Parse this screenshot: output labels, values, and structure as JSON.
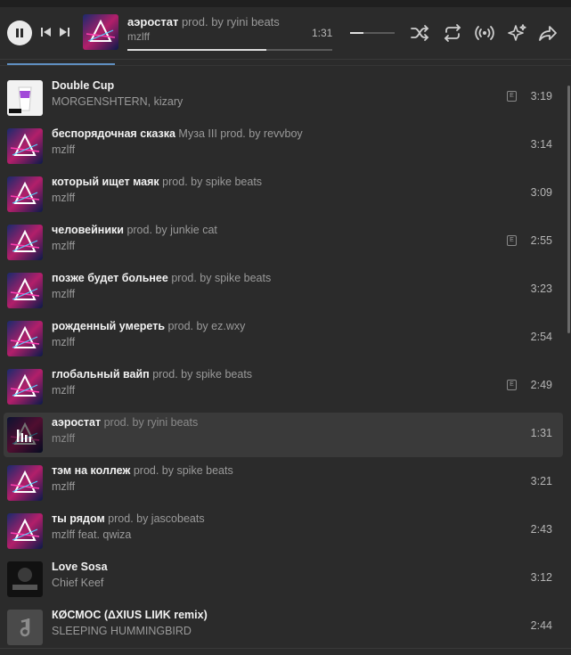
{
  "now_playing": {
    "title": "аэростат",
    "title_suffix": "prod. by ryini beats",
    "artist": "mzlff",
    "time": "1:31",
    "progress": 0.68,
    "volume": 0.3
  },
  "icons": {
    "play_pause": "pause-icon",
    "prev": "previous-icon",
    "next": "next-icon",
    "shuffle": "shuffle-icon",
    "repeat": "repeat-icon",
    "broadcast": "broadcast-icon",
    "sparkle": "sparkle-icon",
    "share": "share-icon"
  },
  "colors": {
    "accent": "#5f8fc1",
    "active_row": "#3a3a3a"
  },
  "tracks": [
    {
      "title": "Double Cup",
      "suffix": "",
      "artist": "MORGENSHTERN, kizary",
      "duration": "3:19",
      "explicit": "E",
      "cover": "doublecup"
    },
    {
      "title": "беспорядочная сказка",
      "suffix": "Муза III prod. by revvboy",
      "artist": "mzlff",
      "duration": "3:14",
      "explicit": "",
      "cover": "neon"
    },
    {
      "title": "который ищет маяк",
      "suffix": "prod. by spike beats",
      "artist": "mzlff",
      "duration": "3:09",
      "explicit": "",
      "cover": "neon"
    },
    {
      "title": "человейники",
      "suffix": "prod. by junkie cat",
      "artist": "mzlff",
      "duration": "2:55",
      "explicit": "E",
      "cover": "neon"
    },
    {
      "title": "позже будет больнее",
      "suffix": "prod. by spike beats",
      "artist": "mzlff",
      "duration": "3:23",
      "explicit": "",
      "cover": "neon"
    },
    {
      "title": "рожденный умереть",
      "suffix": "prod. by ez.wxy",
      "artist": "mzlff",
      "duration": "2:54",
      "explicit": "",
      "cover": "neon"
    },
    {
      "title": "глобальный вайп",
      "suffix": "prod. by spike beats",
      "artist": "mzlff",
      "duration": "2:49",
      "explicit": "E",
      "cover": "neon"
    },
    {
      "title": "аэростат",
      "suffix": "prod. by ryini beats",
      "artist": "mzlff",
      "duration": "1:31",
      "explicit": "",
      "cover": "playing",
      "active": true
    },
    {
      "title": "тэм на коллеж",
      "suffix": "prod. by spike beats",
      "artist": "mzlff",
      "duration": "3:21",
      "explicit": "",
      "cover": "neon"
    },
    {
      "title": "ты рядом",
      "suffix": "prod. by jascobeats",
      "artist": "mzlff feat. qwiza",
      "duration": "2:43",
      "explicit": "",
      "cover": "neon"
    },
    {
      "title": "Love Sosa",
      "suffix": "",
      "artist": "Chief Keef",
      "duration": "3:12",
      "explicit": "",
      "cover": "chiefkeef"
    },
    {
      "title": "КØСМОС (ΔXIUS LIИK remix)",
      "suffix": "",
      "artist": "SLEEPING HUMMINGBIRD",
      "duration": "2:44",
      "explicit": "",
      "cover": "note"
    }
  ]
}
